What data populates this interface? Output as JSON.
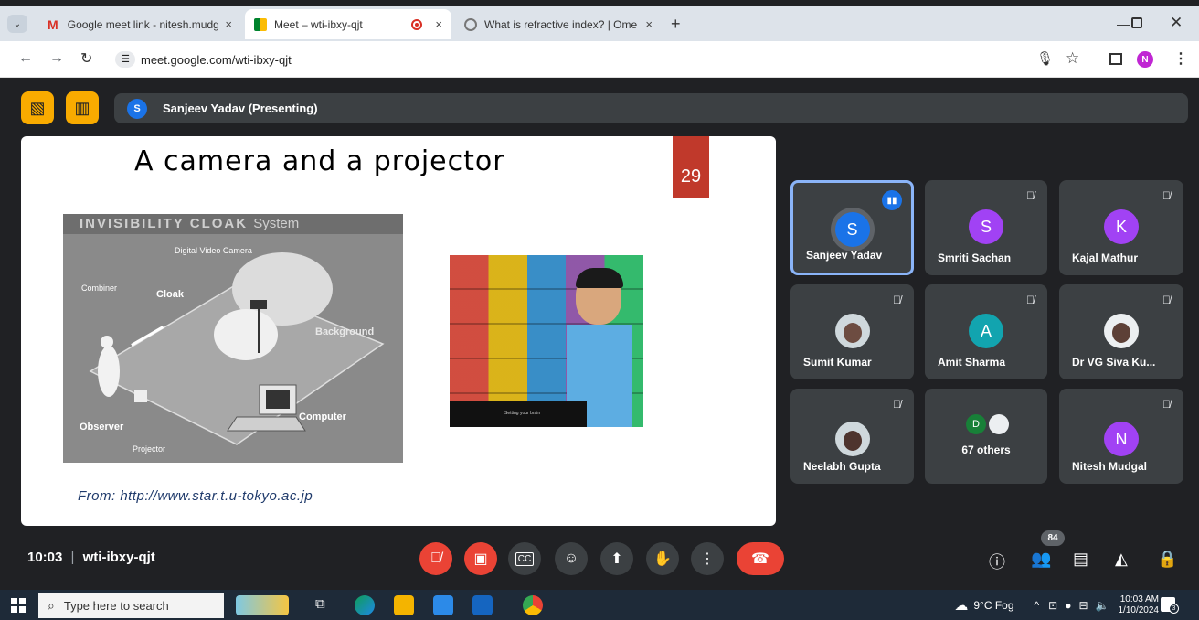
{
  "browser": {
    "tabs": [
      {
        "title": "Google meet link - nitesh.mudg",
        "close": "×"
      },
      {
        "title": "Meet – wti-ibxy-qjt",
        "close": "×"
      },
      {
        "title": "What is refractive index? | Ome",
        "close": "×"
      }
    ],
    "new_tab": "+",
    "url": "meet.google.com/wti-ibxy-qjt",
    "profile_initial": "N",
    "colors": {
      "tab_bar": "#dde3ea",
      "active_tab": "#ffffff"
    }
  },
  "meet": {
    "presenter_initial": "S",
    "presenter_label": "Sanjeev Yadav (Presenting)",
    "slide": {
      "title": "A camera and  a projector",
      "number": "29",
      "diagram_header": "INVISIBILITY CLOAK",
      "diagram_header_suffix": "System",
      "diagram_labels": {
        "camera": "Digital Video Camera",
        "combiner": "Combiner",
        "cloak": "Cloak",
        "background": "Background",
        "computer": "Computer",
        "observer": "Observer",
        "projector": "Projector"
      },
      "photo_caption": "Setting your brain",
      "source": "From: http://www.star.t.u-tokyo.ac.jp"
    },
    "participants": [
      {
        "name": "Sanjeev Yadav",
        "initial": "S",
        "color": "#1a73e8",
        "speaking": true
      },
      {
        "name": "Smriti Sachan",
        "initial": "S",
        "color": "#a142f4"
      },
      {
        "name": "Kajal Mathur",
        "initial": "K",
        "color": "#a142f4"
      },
      {
        "name": "Sumit Kumar",
        "photo": true
      },
      {
        "name": "Amit Sharma",
        "initial": "A",
        "color": "#12a4af"
      },
      {
        "name": "Dr VG Siva Ku...",
        "photo": true
      },
      {
        "name": "Neelabh Gupta",
        "photo": true
      },
      {
        "name": "67 others",
        "initial": "D",
        "color": "#188038"
      },
      {
        "name": "Nitesh Mudgal",
        "initial": "N",
        "color": "#a142f4"
      }
    ],
    "time": "10:03",
    "separator": "|",
    "meeting_code": "wti-ibxy-qjt",
    "people_count": "84",
    "colors": {
      "background": "#202124",
      "tile": "#3c4043",
      "hangup": "#ea4335",
      "highlight": "#f9ab00"
    }
  },
  "taskbar": {
    "search_placeholder": "Type here to search",
    "weather": "9°C  Fog",
    "clock_time": "10:03 AM",
    "clock_date": "1/10/2024",
    "notifications": "3"
  }
}
